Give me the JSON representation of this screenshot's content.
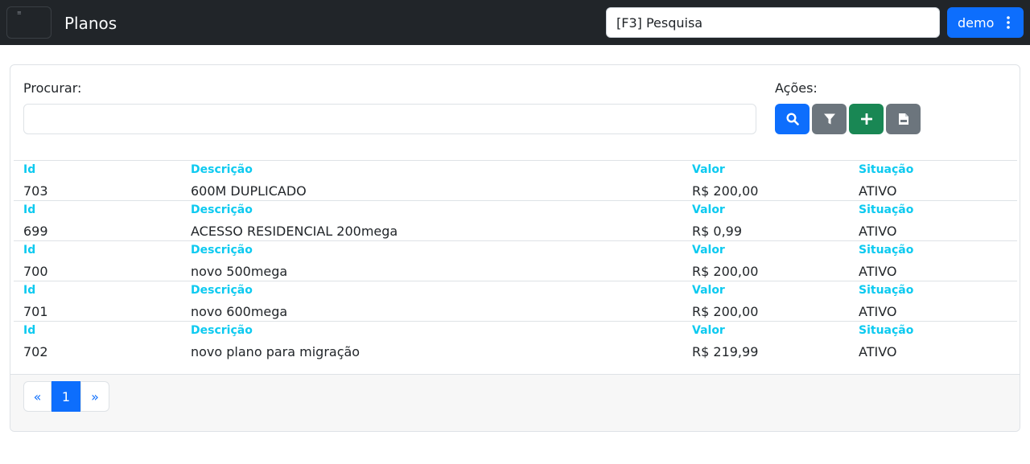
{
  "header": {
    "title": "Planos",
    "search_value": "[F3] Pesquisa",
    "user_label": "demo",
    "icons": {
      "menu": "menu-icon",
      "more": "vertical-dots-icon"
    }
  },
  "filters": {
    "search_label": "Procurar:",
    "search_value": "",
    "actions_label": "Ações:",
    "actions": [
      {
        "name": "search",
        "icon": "search-icon",
        "color": "#0d6efd"
      },
      {
        "name": "filter",
        "icon": "filter-icon",
        "color": "#6c757d"
      },
      {
        "name": "add",
        "icon": "plus-icon",
        "color": "#198754"
      },
      {
        "name": "export-csv",
        "icon": "csv-file-icon",
        "color": "#6c757d"
      }
    ]
  },
  "columns": {
    "id": "Id",
    "desc": "Descrição",
    "value": "Valor",
    "status": "Situação"
  },
  "rows": [
    {
      "id": "703",
      "desc": "600M DUPLICADO",
      "value": "R$ 200,00",
      "status": "ATIVO"
    },
    {
      "id": "699",
      "desc": "ACESSO RESIDENCIAL 200mega",
      "value": "R$ 0,99",
      "status": "ATIVO"
    },
    {
      "id": "700",
      "desc": "novo 500mega",
      "value": "R$ 200,00",
      "status": "ATIVO"
    },
    {
      "id": "701",
      "desc": "novo 600mega",
      "value": "R$ 200,00",
      "status": "ATIVO"
    },
    {
      "id": "702",
      "desc": "novo plano para migração",
      "value": "R$ 219,99",
      "status": "ATIVO"
    }
  ],
  "pagination": {
    "prev": "«",
    "current": "1",
    "next": "»"
  },
  "colors": {
    "header_bg": "#212529",
    "primary": "#0d6efd",
    "label_accent": "#0dcaf0",
    "success": "#198754",
    "secondary": "#6c757d"
  }
}
